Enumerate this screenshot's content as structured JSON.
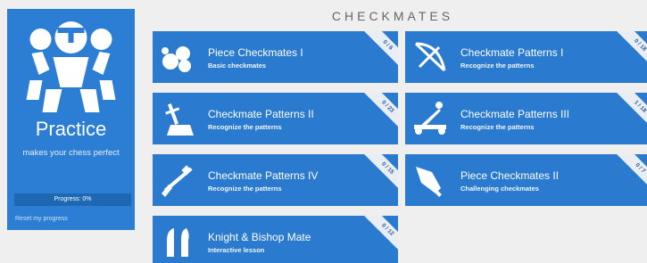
{
  "sidebar": {
    "title": "Practice",
    "subtitle": "makes your chess perfect",
    "progress": "Progress: 0%",
    "progress_value": 0,
    "reset": "Reset my progress"
  },
  "header": {
    "title": "CHECKMATES"
  },
  "cards": [
    {
      "title": "Piece Checkmates I",
      "subtitle": "Basic checkmates",
      "progress": "0 / 6",
      "icon": "rocks-icon"
    },
    {
      "title": "Checkmate Patterns I",
      "subtitle": "Recognize the patterns",
      "progress": "0 / 18",
      "icon": "crossbow-icon"
    },
    {
      "title": "Checkmate Patterns II",
      "subtitle": "Recognize the patterns",
      "progress": "0 / 23",
      "icon": "sword-in-stone-icon"
    },
    {
      "title": "Checkmate Patterns III",
      "subtitle": "Recognize the patterns",
      "progress": "1 / 18",
      "icon": "catapult-icon"
    },
    {
      "title": "Checkmate Patterns IV",
      "subtitle": "Recognize the patterns",
      "progress": "0 / 15",
      "icon": "musket-icon"
    },
    {
      "title": "Piece Checkmates II",
      "subtitle": "Challenging checkmates",
      "progress": "0 / 7",
      "icon": "spear-head-icon"
    },
    {
      "title": "Knight & Bishop Mate",
      "subtitle": "Interactive lesson",
      "progress": "0 / 12",
      "icon": "knight-bishop-icon"
    }
  ],
  "colors": {
    "accent": "#2a7ad0",
    "sidebar": "#2b7ed3",
    "background": "#efefef"
  }
}
